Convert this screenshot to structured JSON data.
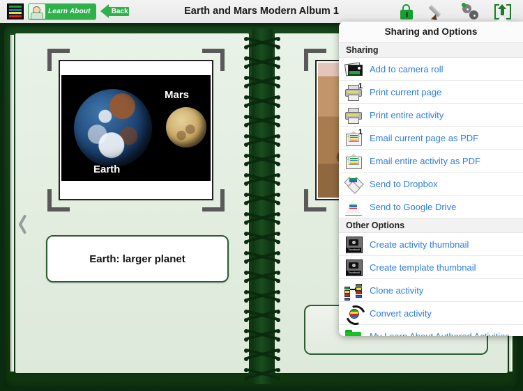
{
  "toolbar": {
    "stack_icon": "stack-icon",
    "learn_about_label": "Learn About",
    "back_label": "Back",
    "title": "Earth and Mars Modern Album 1",
    "icons": [
      {
        "name": "lock-icon",
        "label": "Lock"
      },
      {
        "name": "pencil-icon",
        "label": "Edit"
      },
      {
        "name": "gears-icon",
        "label": "Settings"
      },
      {
        "name": "share-icon",
        "label": "Share"
      }
    ]
  },
  "book": {
    "left_page": {
      "photo": {
        "label_mars": "Mars",
        "label_earth": "Earth",
        "alt": "Earth and Mars size comparison on black background"
      },
      "caption": "Earth: larger planet"
    },
    "right_page": {
      "photo": {
        "alt": "Mars rocky surface photograph"
      },
      "caption": ""
    },
    "nav_prev": "previous-page"
  },
  "popover": {
    "title": "Sharing and Options",
    "sections": [
      {
        "header": "Sharing",
        "items": [
          {
            "icon": "camera-roll-icon",
            "label": "Add to camera roll"
          },
          {
            "icon": "printer-page-icon",
            "label": "Print current page",
            "badge": "1"
          },
          {
            "icon": "printer-icon",
            "label": "Print entire activity"
          },
          {
            "icon": "email-page-pdf-icon",
            "label": "Email current page as PDF",
            "badge": "1"
          },
          {
            "icon": "email-activity-pdf-icon",
            "label": "Email entire activity as PDF"
          },
          {
            "icon": "dropbox-icon",
            "label": "Send to Dropbox"
          },
          {
            "icon": "google-drive-icon",
            "label": "Send to Google Drive"
          }
        ]
      },
      {
        "header": "Other Options",
        "items": [
          {
            "icon": "thumbnail-icon",
            "label": "Create activity thumbnail",
            "badge_text": "Thumbnail"
          },
          {
            "icon": "thumbnail-icon",
            "label": "Create template thumbnail",
            "badge_text": "Thumbnail"
          },
          {
            "icon": "clone-icon",
            "label": "Clone activity"
          },
          {
            "icon": "convert-icon",
            "label": "Convert activity"
          },
          {
            "icon": "folder-icon",
            "label": "My Learn About Authored Activities"
          }
        ]
      }
    ]
  },
  "colors": {
    "link": "#2d7ddd",
    "brand_green": "#2fb14a",
    "book_cover": "#174a1d",
    "page": "#e9f2e7"
  }
}
